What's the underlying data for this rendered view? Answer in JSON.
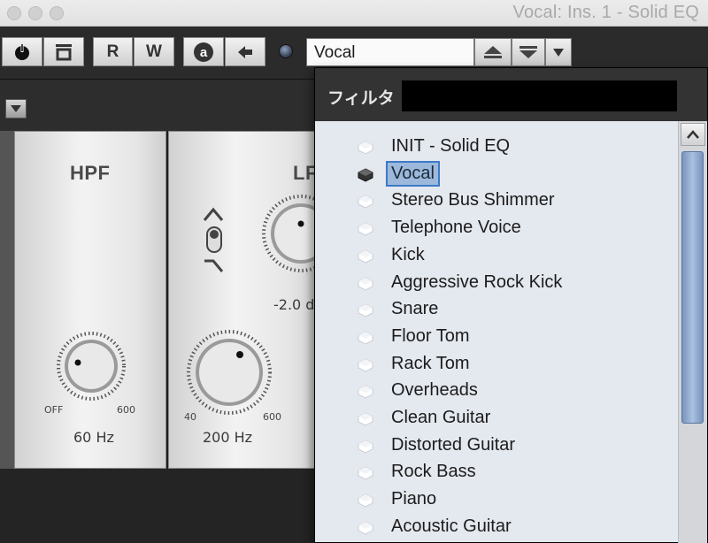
{
  "window": {
    "title": "Vocal: Ins. 1 - Solid EQ"
  },
  "toolbar": {
    "read_label": "R",
    "write_label": "W",
    "auto_label": "a",
    "preset_value": "Vocal"
  },
  "plugin": {
    "hpf": {
      "title": "HPF",
      "freq_value": "60 Hz",
      "min_label": "OFF",
      "max_label": "600"
    },
    "lpf": {
      "title": "LF",
      "gain_value": "-2.0 d",
      "freq_value": "200 Hz",
      "min_label": "40",
      "max_label": "600"
    }
  },
  "dropdown": {
    "filter_label": "フィルタ",
    "filter_value": "",
    "selected_index": 1,
    "items": [
      "INIT - Solid EQ",
      "Vocal",
      "Stereo Bus Shimmer",
      "Telephone Voice",
      "Kick",
      "Aggressive Rock Kick",
      "Snare",
      "Floor Tom",
      "Rack Tom",
      "Overheads",
      "Clean Guitar",
      "Distorted Guitar",
      "Rock Bass",
      "Piano",
      "Acoustic Guitar"
    ]
  },
  "colors": {
    "selection": "#9cb9dc",
    "selection_outline": "#3d79c8",
    "list_bg": "#e4e8ef",
    "scroll_thumb": "#8aa6cc"
  }
}
